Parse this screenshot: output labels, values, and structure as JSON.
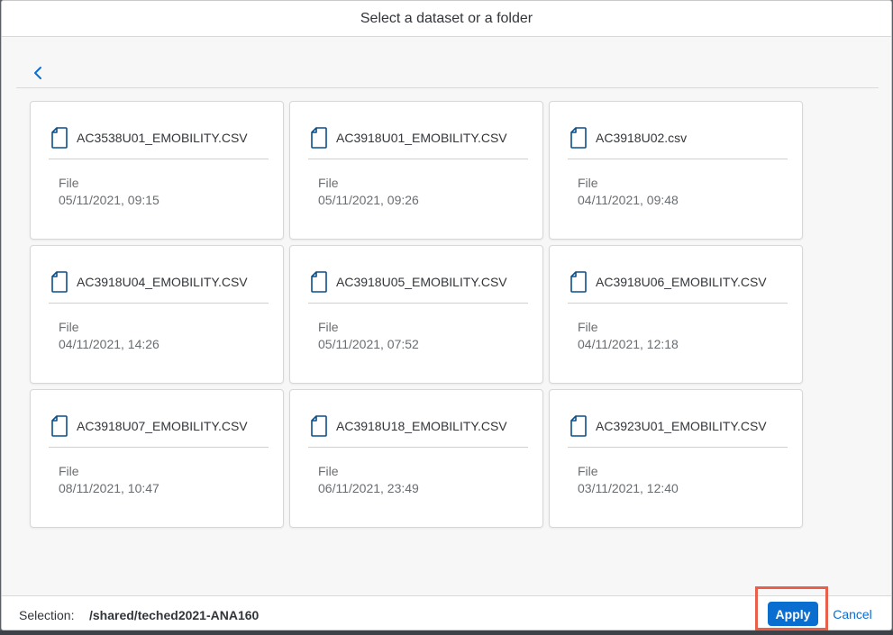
{
  "dialog": {
    "title": "Select a dataset or a folder"
  },
  "nav": {
    "back_icon": "chevron-left-icon"
  },
  "items": [
    {
      "name": "AC3538U01_EMOBILITY.CSV",
      "type": "File",
      "modified": "05/11/2021, 09:15",
      "icon": "document-icon"
    },
    {
      "name": "AC3918U01_EMOBILITY.CSV",
      "type": "File",
      "modified": "05/11/2021, 09:26",
      "icon": "document-icon"
    },
    {
      "name": "AC3918U02.csv",
      "type": "File",
      "modified": "04/11/2021, 09:48",
      "icon": "document-icon"
    },
    {
      "name": "AC3918U04_EMOBILITY.CSV",
      "type": "File",
      "modified": "04/11/2021, 14:26",
      "icon": "document-icon"
    },
    {
      "name": "AC3918U05_EMOBILITY.CSV",
      "type": "File",
      "modified": "05/11/2021, 07:52",
      "icon": "document-icon"
    },
    {
      "name": "AC3918U06_EMOBILITY.CSV",
      "type": "File",
      "modified": "04/11/2021, 12:18",
      "icon": "document-icon"
    },
    {
      "name": "AC3918U07_EMOBILITY.CSV",
      "type": "File",
      "modified": "08/11/2021, 10:47",
      "icon": "document-icon"
    },
    {
      "name": "AC3918U18_EMOBILITY.CSV",
      "type": "File",
      "modified": "06/11/2021, 23:49",
      "icon": "document-icon"
    },
    {
      "name": "AC3923U01_EMOBILITY.CSV",
      "type": "File",
      "modified": "03/11/2021, 12:40",
      "icon": "document-icon"
    }
  ],
  "footer": {
    "selection_label": "Selection:",
    "selection_value": "/shared/teched2021-ANA160",
    "apply_label": "Apply",
    "cancel_label": "Cancel"
  },
  "colors": {
    "accent": "#0a6ed1",
    "highlight": "#e8604c",
    "icon": "#0b4f8a"
  }
}
